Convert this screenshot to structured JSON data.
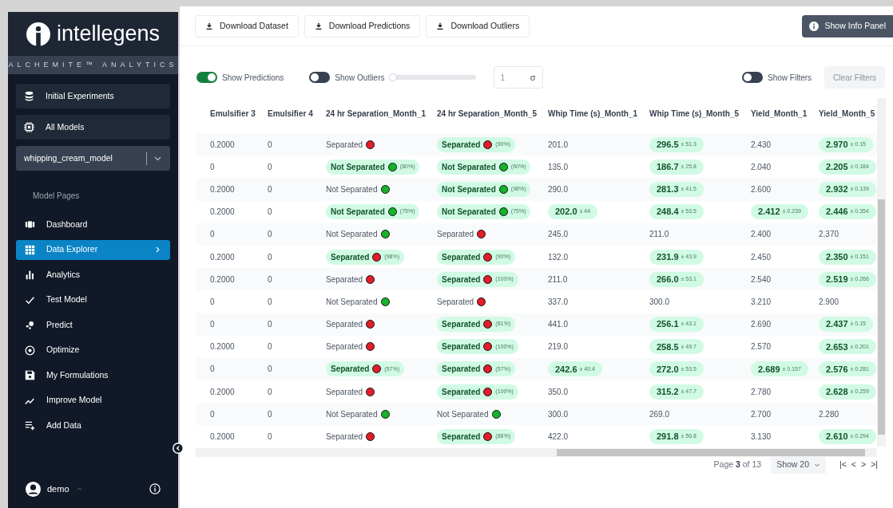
{
  "sidebar": {
    "logo": "intellegens",
    "subtitle": "ALCHEMITE™ ANALYTICS",
    "top_items": [
      {
        "label": "Initial Experiments"
      },
      {
        "label": "All Models"
      }
    ],
    "model_select": {
      "value": "whipping_cream_model"
    },
    "section_label": "Model Pages",
    "items": [
      {
        "label": "Dashboard",
        "selected": false
      },
      {
        "label": "Data Explorer",
        "selected": true
      },
      {
        "label": "Analytics",
        "selected": false
      },
      {
        "label": "Test Model",
        "selected": false
      },
      {
        "label": "Predict",
        "selected": false
      },
      {
        "label": "Optimize",
        "selected": false
      },
      {
        "label": "My Formulations",
        "selected": false
      },
      {
        "label": "Improve Model",
        "selected": false
      },
      {
        "label": "Add Data",
        "selected": false
      }
    ],
    "user": "demo"
  },
  "toolbar": {
    "buttons": [
      "Download Dataset",
      "Download Predictions",
      "Download Outliers"
    ],
    "info_button": "Show Info Panel"
  },
  "controls": {
    "show_predictions": {
      "label": "Show Predictions",
      "on": true
    },
    "show_outliers": {
      "label": "Show Outliers",
      "on": false,
      "level": 0
    },
    "sigma": {
      "value": "1",
      "unit": "σ"
    },
    "show_filters": {
      "label": "Show Filters",
      "on": false
    },
    "clear_filters": {
      "label": "Clear Filters",
      "disabled": true
    }
  },
  "table": {
    "columns": [
      "Emulsifier 3",
      "Emulsifier 4",
      "24 hr Separation_Month_1",
      "24 hr Separation_Month_5",
      "Whip Time (s)_Month_1",
      "Whip Time (s)_Month_5",
      "Yield_Month_1",
      "Yield_Month_5"
    ],
    "rows": [
      [
        {
          "kind": "plain",
          "text": "0.2000"
        },
        {
          "kind": "plain",
          "text": "0"
        },
        {
          "kind": "status",
          "text": "Separated",
          "color": "#e11d2a",
          "predicted": false
        },
        {
          "kind": "status",
          "text": "Separated",
          "color": "#e11d2a",
          "predicted": true,
          "note": "(90%)"
        },
        {
          "kind": "number",
          "text": "201.0",
          "predicted": false
        },
        {
          "kind": "number",
          "text": "296.5",
          "predicted": true,
          "note": "± 51.3"
        },
        {
          "kind": "number",
          "text": "2.430",
          "predicted": false
        },
        {
          "kind": "number",
          "text": "2.970",
          "predicted": true,
          "note": "± 0.15"
        }
      ],
      [
        {
          "kind": "plain",
          "text": "0"
        },
        {
          "kind": "plain",
          "text": "0"
        },
        {
          "kind": "status",
          "text": "Not Separated",
          "color": "#16b22a",
          "predicted": true,
          "note": "(80%)"
        },
        {
          "kind": "status",
          "text": "Not Separated",
          "color": "#16b22a",
          "predicted": true,
          "note": "(60%)"
        },
        {
          "kind": "number",
          "text": "135.0",
          "predicted": false
        },
        {
          "kind": "number",
          "text": "186.7",
          "predicted": true,
          "note": "± 25.8"
        },
        {
          "kind": "number",
          "text": "2.040",
          "predicted": false
        },
        {
          "kind": "number",
          "text": "2.205",
          "predicted": true,
          "note": "± 0.184"
        }
      ],
      [
        {
          "kind": "plain",
          "text": "0.2000"
        },
        {
          "kind": "plain",
          "text": "0"
        },
        {
          "kind": "status",
          "text": "Not Separated",
          "color": "#16b22a",
          "predicted": false
        },
        {
          "kind": "status",
          "text": "Not Separated",
          "color": "#16b22a",
          "predicted": true,
          "note": "(98%)"
        },
        {
          "kind": "number",
          "text": "290.0",
          "predicted": false
        },
        {
          "kind": "number",
          "text": "281.3",
          "predicted": true,
          "note": "± 41.5"
        },
        {
          "kind": "number",
          "text": "2.600",
          "predicted": false
        },
        {
          "kind": "number",
          "text": "2.932",
          "predicted": true,
          "note": "± 0.139"
        }
      ],
      [
        {
          "kind": "plain",
          "text": "0.2000"
        },
        {
          "kind": "plain",
          "text": "0"
        },
        {
          "kind": "status",
          "text": "Not Separated",
          "color": "#16b22a",
          "predicted": true,
          "note": "(75%)"
        },
        {
          "kind": "status",
          "text": "Not Separated",
          "color": "#16b22a",
          "predicted": true,
          "note": "(75%)"
        },
        {
          "kind": "number",
          "text": "202.0",
          "predicted": true,
          "note": "± 44"
        },
        {
          "kind": "number",
          "text": "248.4",
          "predicted": true,
          "note": "± 53.5"
        },
        {
          "kind": "number",
          "text": "2.412",
          "predicted": true,
          "note": "± 0.239"
        },
        {
          "kind": "number",
          "text": "2.446",
          "predicted": true,
          "note": "± 0.354"
        }
      ],
      [
        {
          "kind": "plain",
          "text": "0"
        },
        {
          "kind": "plain",
          "text": "0"
        },
        {
          "kind": "status",
          "text": "Not Separated",
          "color": "#16b22a",
          "predicted": false
        },
        {
          "kind": "status",
          "text": "Separated",
          "color": "#e11d2a",
          "predicted": false
        },
        {
          "kind": "number",
          "text": "245.0",
          "predicted": false
        },
        {
          "kind": "number",
          "text": "211.0",
          "predicted": false
        },
        {
          "kind": "number",
          "text": "2.400",
          "predicted": false
        },
        {
          "kind": "number",
          "text": "2.370",
          "predicted": false
        }
      ],
      [
        {
          "kind": "plain",
          "text": "0.2000"
        },
        {
          "kind": "plain",
          "text": "0"
        },
        {
          "kind": "status",
          "text": "Separated",
          "color": "#e11d2a",
          "predicted": true,
          "note": "(98%)"
        },
        {
          "kind": "status",
          "text": "Separated",
          "color": "#e11d2a",
          "predicted": true,
          "note": "(90%)"
        },
        {
          "kind": "number",
          "text": "132.0",
          "predicted": false
        },
        {
          "kind": "number",
          "text": "231.9",
          "predicted": true,
          "note": "± 43.9"
        },
        {
          "kind": "number",
          "text": "2.450",
          "predicted": false
        },
        {
          "kind": "number",
          "text": "2.350",
          "predicted": true,
          "note": "± 0.151"
        }
      ],
      [
        {
          "kind": "plain",
          "text": "0.2000"
        },
        {
          "kind": "plain",
          "text": "0"
        },
        {
          "kind": "status",
          "text": "Separated",
          "color": "#e11d2a",
          "predicted": false
        },
        {
          "kind": "status",
          "text": "Separated",
          "color": "#e11d2a",
          "predicted": true,
          "note": "(100%)"
        },
        {
          "kind": "number",
          "text": "211.0",
          "predicted": false
        },
        {
          "kind": "number",
          "text": "266.0",
          "predicted": true,
          "note": "± 53.1"
        },
        {
          "kind": "number",
          "text": "2.540",
          "predicted": false
        },
        {
          "kind": "number",
          "text": "2.519",
          "predicted": true,
          "note": "± 0.266"
        }
      ],
      [
        {
          "kind": "plain",
          "text": "0"
        },
        {
          "kind": "plain",
          "text": "0"
        },
        {
          "kind": "status",
          "text": "Not Separated",
          "color": "#16b22a",
          "predicted": false
        },
        {
          "kind": "status",
          "text": "Separated",
          "color": "#e11d2a",
          "predicted": false
        },
        {
          "kind": "number",
          "text": "337.0",
          "predicted": false
        },
        {
          "kind": "number",
          "text": "300.0",
          "predicted": false
        },
        {
          "kind": "number",
          "text": "3.210",
          "predicted": false
        },
        {
          "kind": "number",
          "text": "2.900",
          "predicted": false
        }
      ],
      [
        {
          "kind": "plain",
          "text": "0"
        },
        {
          "kind": "plain",
          "text": "0"
        },
        {
          "kind": "status",
          "text": "Separated",
          "color": "#e11d2a",
          "predicted": false
        },
        {
          "kind": "status",
          "text": "Separated",
          "color": "#e11d2a",
          "predicted": true,
          "note": "(81%)"
        },
        {
          "kind": "number",
          "text": "441.0",
          "predicted": false
        },
        {
          "kind": "number",
          "text": "256.1",
          "predicted": true,
          "note": "± 43.1"
        },
        {
          "kind": "number",
          "text": "2.690",
          "predicted": false
        },
        {
          "kind": "number",
          "text": "2.437",
          "predicted": true,
          "note": "± 0.15"
        }
      ],
      [
        {
          "kind": "plain",
          "text": "0.2000"
        },
        {
          "kind": "plain",
          "text": "0"
        },
        {
          "kind": "status",
          "text": "Separated",
          "color": "#e11d2a",
          "predicted": false
        },
        {
          "kind": "status",
          "text": "Separated",
          "color": "#e11d2a",
          "predicted": true,
          "note": "(100%)"
        },
        {
          "kind": "number",
          "text": "219.0",
          "predicted": false
        },
        {
          "kind": "number",
          "text": "258.5",
          "predicted": true,
          "note": "± 49.7"
        },
        {
          "kind": "number",
          "text": "2.570",
          "predicted": false
        },
        {
          "kind": "number",
          "text": "2.653",
          "predicted": true,
          "note": "± 0.201"
        }
      ],
      [
        {
          "kind": "plain",
          "text": "0"
        },
        {
          "kind": "plain",
          "text": "0"
        },
        {
          "kind": "status",
          "text": "Separated",
          "color": "#e11d2a",
          "predicted": true,
          "note": "(57%)"
        },
        {
          "kind": "status",
          "text": "Separated",
          "color": "#e11d2a",
          "predicted": true,
          "note": "(57%)"
        },
        {
          "kind": "number",
          "text": "242.6",
          "predicted": true,
          "note": "± 40.4"
        },
        {
          "kind": "number",
          "text": "272.0",
          "predicted": true,
          "note": "± 53.5"
        },
        {
          "kind": "number",
          "text": "2.689",
          "predicted": true,
          "note": "± 0.157"
        },
        {
          "kind": "number",
          "text": "2.576",
          "predicted": true,
          "note": "± 0.281"
        }
      ],
      [
        {
          "kind": "plain",
          "text": "0.2000"
        },
        {
          "kind": "plain",
          "text": "0"
        },
        {
          "kind": "status",
          "text": "Separated",
          "color": "#e11d2a",
          "predicted": false
        },
        {
          "kind": "status",
          "text": "Separated",
          "color": "#e11d2a",
          "predicted": true,
          "note": "(100%)"
        },
        {
          "kind": "number",
          "text": "350.0",
          "predicted": false
        },
        {
          "kind": "number",
          "text": "315.2",
          "predicted": true,
          "note": "± 47.7"
        },
        {
          "kind": "number",
          "text": "2.780",
          "predicted": false
        },
        {
          "kind": "number",
          "text": "2.628",
          "predicted": true,
          "note": "± 0.259"
        }
      ],
      [
        {
          "kind": "plain",
          "text": "0"
        },
        {
          "kind": "plain",
          "text": "0"
        },
        {
          "kind": "status",
          "text": "Not Separated",
          "color": "#16b22a",
          "predicted": false
        },
        {
          "kind": "status",
          "text": "Not Separated",
          "color": "#16b22a",
          "predicted": false
        },
        {
          "kind": "number",
          "text": "300.0",
          "predicted": false
        },
        {
          "kind": "number",
          "text": "269.0",
          "predicted": false
        },
        {
          "kind": "number",
          "text": "2.700",
          "predicted": false
        },
        {
          "kind": "number",
          "text": "2.280",
          "predicted": false
        }
      ],
      [
        {
          "kind": "plain",
          "text": "0.2000"
        },
        {
          "kind": "plain",
          "text": "0"
        },
        {
          "kind": "status",
          "text": "Separated",
          "color": "#e11d2a",
          "predicted": false
        },
        {
          "kind": "status",
          "text": "Separated",
          "color": "#e11d2a",
          "predicted": true,
          "note": "(86%)"
        },
        {
          "kind": "number",
          "text": "422.0",
          "predicted": false
        },
        {
          "kind": "number",
          "text": "291.8",
          "predicted": true,
          "note": "± 56.8"
        },
        {
          "kind": "number",
          "text": "3.130",
          "predicted": false
        },
        {
          "kind": "number",
          "text": "2.610",
          "predicted": true,
          "note": "± 0.294"
        }
      ]
    ]
  },
  "pagination": {
    "page_label": "Page",
    "page": "3",
    "of_label": "of 13",
    "page_size": "Show 20",
    "nav": [
      "|<",
      "<",
      ">",
      ">|"
    ]
  }
}
